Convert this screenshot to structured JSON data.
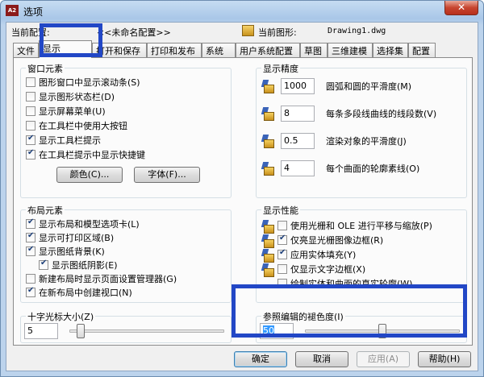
{
  "window": {
    "title": "选项",
    "app_icon_text": "A2",
    "close_glyph": "✕"
  },
  "current_profile": {
    "label": "当前配置:",
    "value": "<<未命名配置>>"
  },
  "current_drawing": {
    "label": "当前图形:",
    "value": "Drawing1.dwg"
  },
  "tabs": [
    "文件",
    "显示",
    "打开和保存",
    "打印和发布",
    "系统",
    "用户系统配置",
    "草图",
    "三维建模",
    "选择集",
    "配置"
  ],
  "active_tab": "显示",
  "window_elements": {
    "title": "窗口元素",
    "checkboxes": [
      {
        "label": "图形窗口中显示滚动条(S)",
        "checked": false
      },
      {
        "label": "显示图形状态栏(D)",
        "checked": false
      },
      {
        "label": "显示屏幕菜单(U)",
        "checked": false
      },
      {
        "label": "在工具栏中使用大按钮",
        "checked": false
      },
      {
        "label": "显示工具栏提示",
        "checked": true
      },
      {
        "label": "在工具栏提示中显示快捷键",
        "checked": true
      }
    ],
    "colors_button": "颜色(C)...",
    "fonts_button": "字体(F)..."
  },
  "display_precision": {
    "title": "显示精度",
    "rows": [
      {
        "value": "1000",
        "label": "圆弧和圆的平滑度(M)"
      },
      {
        "value": "8",
        "label": "每条多段线曲线的线段数(V)"
      },
      {
        "value": "0.5",
        "label": "渲染对象的平滑度(J)"
      },
      {
        "value": "4",
        "label": "每个曲面的轮廓素线(O)"
      }
    ]
  },
  "layout_elements": {
    "title": "布局元素",
    "checkboxes": [
      {
        "label": "显示布局和模型选项卡(L)",
        "checked": true,
        "indent": false
      },
      {
        "label": "显示可打印区域(B)",
        "checked": true,
        "indent": false
      },
      {
        "label": "显示图纸背景(K)",
        "checked": true,
        "indent": false
      },
      {
        "label": "显示图纸阴影(E)",
        "checked": true,
        "indent": true
      },
      {
        "label": "新建布局时显示页面设置管理器(G)",
        "checked": false,
        "indent": false
      },
      {
        "label": "在新布局中创建视口(N)",
        "checked": true,
        "indent": false
      }
    ]
  },
  "display_performance": {
    "title": "显示性能",
    "checkboxes": [
      {
        "label": "使用光栅和 OLE 进行平移与缩放(P)",
        "checked": false,
        "indent": false,
        "icon": true
      },
      {
        "label": "仅亮显光栅图像边框(R)",
        "checked": true,
        "indent": false,
        "icon": true
      },
      {
        "label": "应用实体填充(Y)",
        "checked": true,
        "indent": false,
        "icon": true
      },
      {
        "label": "仅显示文字边框(X)",
        "checked": false,
        "indent": false,
        "icon": true
      },
      {
        "label": "绘制实体和曲面的真实轮廓(W)",
        "checked": false,
        "indent": true,
        "icon": false
      }
    ]
  },
  "crosshair": {
    "title": "十字光标大小(Z)",
    "value": "5",
    "slider_fraction": 0.05
  },
  "xref_fade": {
    "title": "参照编辑的褪色度(I)",
    "value": "50",
    "slider_fraction": 0.5
  },
  "buttons": {
    "ok": "确定",
    "cancel": "取消",
    "apply": "应用(A)",
    "help": "帮助(H)"
  },
  "highlight_color": "#2247c6"
}
